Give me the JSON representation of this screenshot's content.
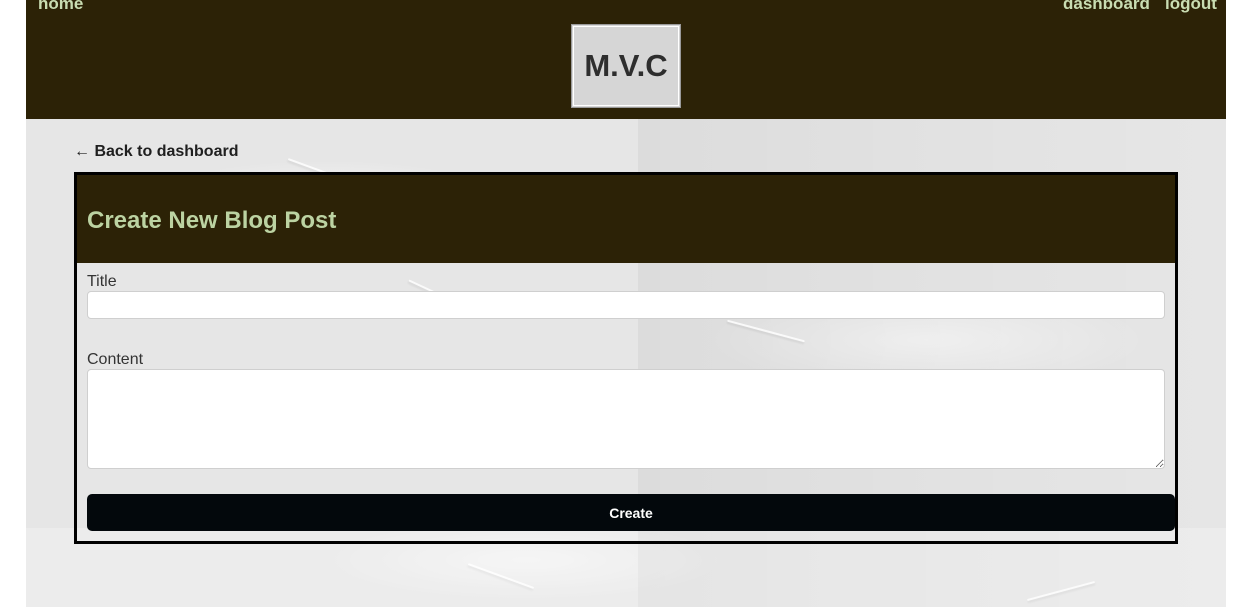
{
  "nav": {
    "home_label": "home",
    "dashboard_label": "dashboard",
    "logout_label": "logout"
  },
  "header": {
    "logo_text": "M.V.C"
  },
  "back_link": {
    "label": "← Back to dashboard"
  },
  "form": {
    "title": "Create New Blog Post",
    "title_field": {
      "label": "Title",
      "value": ""
    },
    "content_field": {
      "label": "Content",
      "value": ""
    },
    "submit_label": "Create"
  },
  "colors": {
    "header_bg": "#2c2206",
    "accent_text": "#c9ddb2",
    "button_bg": "#03080c"
  }
}
